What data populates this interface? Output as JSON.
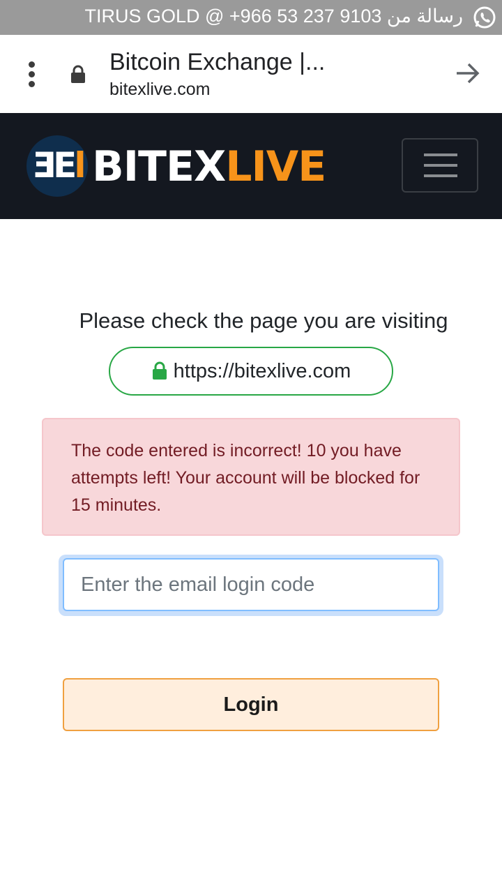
{
  "notification": {
    "text": "رسالة من TIRUS GOLD @ +966 53 237 9103",
    "icon": "whatsapp-icon"
  },
  "browser": {
    "page_title": "Bitcoin Exchange |...",
    "url": "bitexlive.com",
    "menu_icon": "more-vert-icon",
    "lock_icon": "lock-icon",
    "forward_icon": "forward-arrow-icon"
  },
  "site": {
    "logo_mark": "BEL",
    "logo_word_part1": "BITEX",
    "logo_word_part2": "LIVE",
    "menu_icon": "hamburger-icon",
    "colors": {
      "nav_bg": "#141820",
      "accent": "#f7931a"
    }
  },
  "main": {
    "check_heading": "Please check the page you are visiting",
    "secure_url": "https://bitexlive.com",
    "alert_text": "The code entered is incorrect! 10 you have attempts left! Your account will be blocked for 15 minutes.",
    "code_input": {
      "value": "",
      "placeholder": "Enter the email login code"
    },
    "login_label": "Login",
    "colors": {
      "success": "#28a745",
      "danger_bg": "#f8d7da",
      "danger_text": "#721c24",
      "login_border": "#f0a040"
    }
  }
}
